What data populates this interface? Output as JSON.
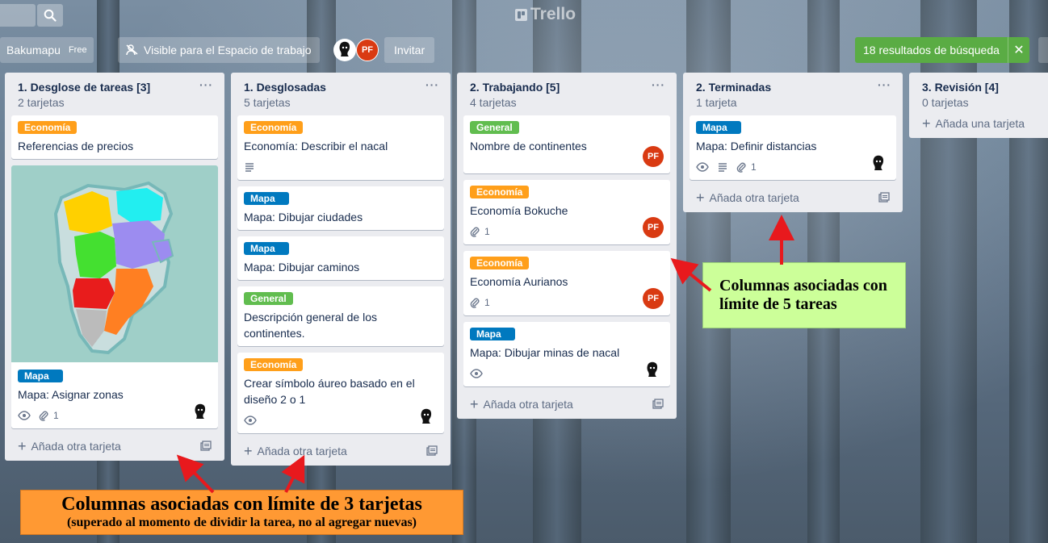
{
  "header": {
    "logo_text": "Trello",
    "search_icon": "search-icon"
  },
  "board_bar": {
    "board_name": "Bakumapu",
    "plan_badge": "Free",
    "visibility_label": "Visible para el Espacio de trabajo",
    "visibility_icon": "team-icon",
    "member_initials": "PF",
    "invite_label": "Invitar",
    "search_results_label": "18 resultados de búsqueda",
    "close_results_symbol": "✕"
  },
  "colors": {
    "label_economia": "#ff9f1a",
    "label_mapa": "#0079bf",
    "label_general": "#61bd4f",
    "avatar_pf": "#d93a12",
    "results_banner": "#5aac44",
    "note_green": "#ccff99",
    "note_orange": "#ff9933",
    "arrow": "#e8191d"
  },
  "lists": [
    {
      "title": "1. Desglose de tareas [3]",
      "count": "2 tarjetas",
      "menu": "···",
      "add_label": "Añada otra tarjeta",
      "cards": [
        {
          "label": "Economía",
          "title": "Referencias de precios"
        },
        {
          "label": "Mapa",
          "title": "Mapa: Asignar zonas",
          "attachments": "1"
        }
      ]
    },
    {
      "title": "1. Desglosadas",
      "count": "5 tarjetas",
      "menu": "···",
      "add_label": "Añada otra tarjeta",
      "cards": [
        {
          "label": "Economía",
          "title": "Economía: Describir el nacal"
        },
        {
          "label": "Mapa",
          "title": "Mapa: Dibujar ciudades"
        },
        {
          "label": "Mapa",
          "title": "Mapa: Dibujar caminos"
        },
        {
          "label": "General",
          "title": "Descripción general de los continentes."
        },
        {
          "label": "Economía",
          "title": "Crear símbolo áureo basado en el diseño 2 o 1"
        }
      ]
    },
    {
      "title": "2. Trabajando [5]",
      "count": "4 tarjetas",
      "menu": "···",
      "add_label": "Añada otra tarjeta",
      "cards": [
        {
          "label": "General",
          "title": "Nombre de continentes",
          "member": "PF"
        },
        {
          "label": "Economía",
          "title": "Economía Bokuche",
          "attachments": "1",
          "member": "PF"
        },
        {
          "label": "Economía",
          "title": "Economía Aurianos",
          "attachments": "1",
          "member": "PF"
        },
        {
          "label": "Mapa",
          "title": "Mapa: Dibujar minas de nacal"
        }
      ]
    },
    {
      "title": "2. Terminadas",
      "count": "1 tarjeta",
      "menu": "···",
      "add_label": "Añada otra tarjeta",
      "cards": [
        {
          "label": "Mapa",
          "title": "Mapa: Definir distancias",
          "attachments": "1"
        }
      ]
    },
    {
      "title": "3. Revisión [4]",
      "count": "0 tarjetas",
      "add_label": "Añada una tarjeta"
    }
  ],
  "annotations": {
    "green_line1": "Columnas asociadas con",
    "green_line2": "límite de 5 tareas",
    "orange_line1": "Columnas asociadas con límite de 3 tarjetas",
    "orange_line2": "(superado al momento de dividir la tarea, no al agregar nuevas)"
  }
}
